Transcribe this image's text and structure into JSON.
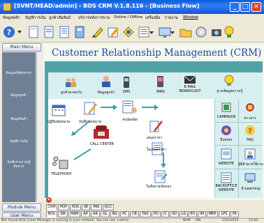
{
  "window": {
    "title": "[SVNT/HEAD/admin] - BOS CRM V.1.8.116 - [Business Flow]",
    "minimize": "_",
    "maximize": "□",
    "close": "✕"
  },
  "menu": [
    "ข้อมูลหลัก",
    "บัญชีการเงิน",
    "ลูกค้าสัมพันธ์",
    "บริการหลังการขาย",
    "Online / Offline",
    "เครื่องมือ",
    "รายงาน",
    "Window"
  ],
  "left_panel": {
    "header": "Main Menu",
    "items": [
      "ข้อมูลบริษัท/สาขา",
      "ข้อมูลลูกค้า",
      "ข้อมูลสินค้า",
      "บัญชีการเงิน",
      "บันทึกรายงาน/ผู้ติดตาม"
    ],
    "module_menu": "Module Menu",
    "user_menu": "User Menu"
  },
  "main": {
    "title": "Customer Relationship Management (CRM)",
    "top_items": [
      "ลูกค้าคาดหวัง",
      "ข้อมูลลูกค้า",
      "SMS",
      "MMS",
      "E-MAIL BOARDCAST",
      "ฐานข้อมูลความรู้"
    ],
    "flow_items": [
      "ปฏิทินนัดหมาย",
      "บันทึกนัดหมาย",
      "สรุปผลนัด",
      "เสนอราคา",
      "CALL CENTER",
      "ใบเสนอราคา",
      "TELEPHONY",
      "ใบสั่งขาย/สั่งจอง"
    ],
    "right_items": [
      "CAMPAIGN",
      "ข่าวสาร",
      "Events",
      "FAQ",
      "WEBSITE",
      "ผู้มีอำนาจใช้งาน",
      "BACKOFFICE WEBSITE",
      "E-Learning"
    ]
  },
  "tabs_row1": [
    "CRM",
    "PDP",
    "PDS",
    "SE",
    "MIS",
    "QCC"
  ],
  "tabs_row2": [
    "BOS",
    "SM",
    "HRM",
    "AP",
    "AR",
    "GL",
    "BG",
    "PC",
    "CB",
    "TAX",
    "PO",
    "IC",
    "SO",
    "LG",
    "EX",
    "IM",
    "MRP",
    "LPS",
    "FA"
  ],
  "status": {
    "message": "Not Found BOS Client Manager is running in your network.  You can use +admin",
    "num": "NUM",
    "ins": "INS",
    "date": "22/5/2550",
    "time": "15:00"
  },
  "colors": {
    "titlebar": "#1455d6",
    "crm_title": "#1f4aa0",
    "teal": "#4fa3a8",
    "panel": "#d8efef"
  }
}
